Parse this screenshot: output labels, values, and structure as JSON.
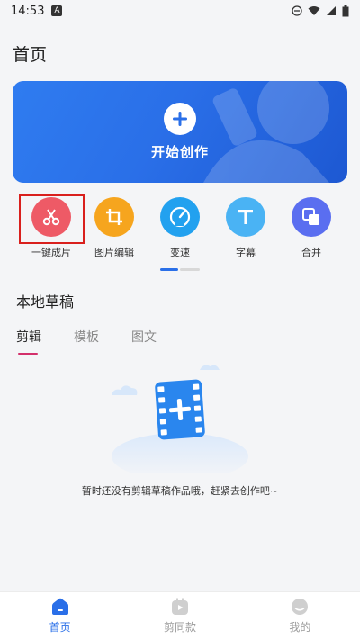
{
  "status": {
    "time": "14:53",
    "badge": "A"
  },
  "header": {
    "title": "首页"
  },
  "hero": {
    "label": "开始创作"
  },
  "tools": [
    {
      "label": "一键成片",
      "icon": "scissors-icon",
      "color": "#ee5a66"
    },
    {
      "label": "图片编辑",
      "icon": "crop-icon",
      "color": "#f6a51e"
    },
    {
      "label": "变速",
      "icon": "speedometer-icon",
      "color": "#22a1ef"
    },
    {
      "label": "字幕",
      "icon": "text-t-icon",
      "color": "#4ab3f4"
    },
    {
      "label": "合并",
      "icon": "merge-icon",
      "color": "#5a6ef0"
    }
  ],
  "drafts": {
    "title": "本地草稿",
    "tabs": [
      {
        "label": "剪辑",
        "active": true
      },
      {
        "label": "模板",
        "active": false
      },
      {
        "label": "图文",
        "active": false
      }
    ],
    "empty_text": "暂时还没有剪辑草稿作品哦，赶紧去创作吧~"
  },
  "nav": [
    {
      "label": "首页",
      "icon": "home-icon",
      "active": true
    },
    {
      "label": "剪同款",
      "icon": "play-icon",
      "active": false
    },
    {
      "label": "我的",
      "icon": "profile-icon",
      "active": false
    }
  ],
  "colors": {
    "accent": "#2a6fe8",
    "highlight": "#d9201d",
    "tab_underline": "#d3306b"
  }
}
